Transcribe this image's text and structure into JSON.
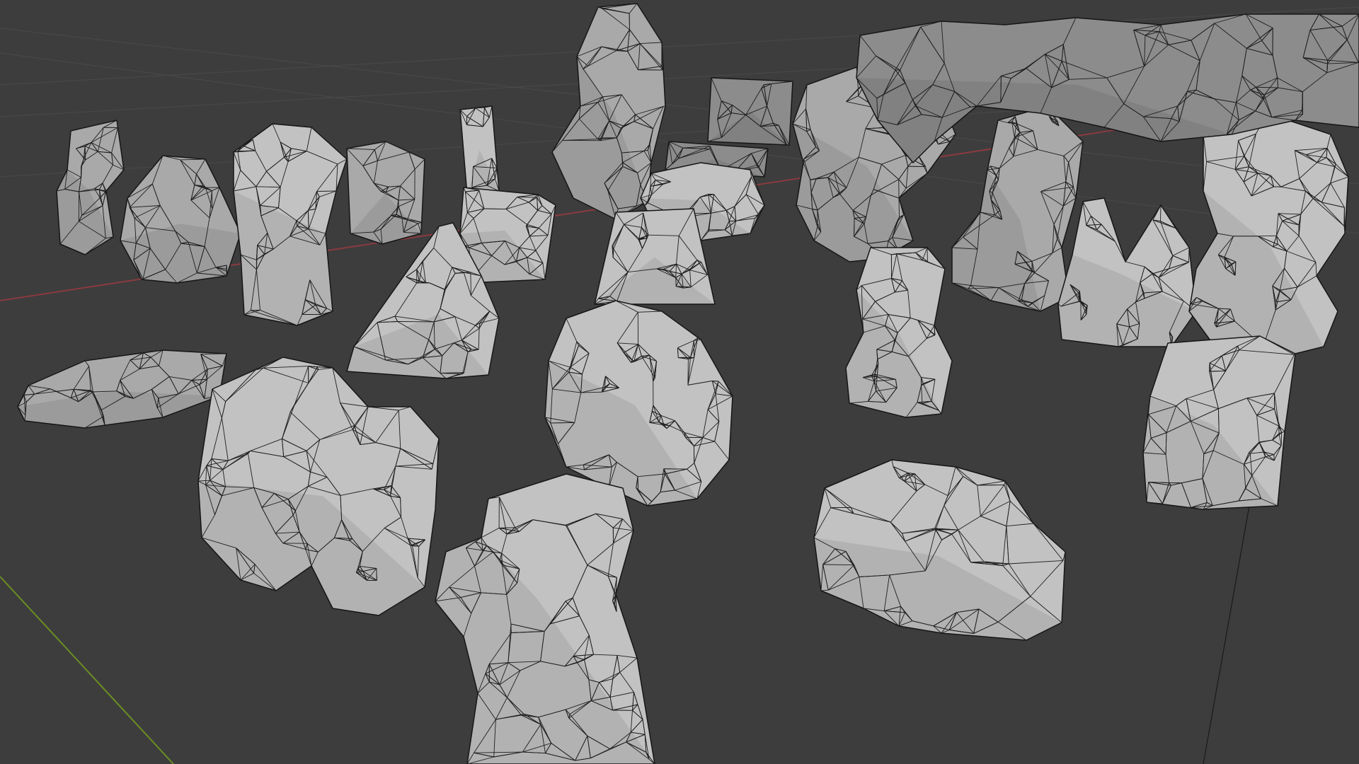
{
  "app": {
    "viewport": "3d-viewport",
    "shading": "solid-with-wireframe-overlay",
    "grid": true,
    "axes": [
      "x-axis-red",
      "y-axis-green"
    ]
  },
  "colors": {
    "background": "#3d3d3d",
    "grid_line": "#4a4a4a",
    "x_axis": "#8a3a3f",
    "y_axis": "#6b8e23",
    "mesh_light": "#c2c2c2",
    "mesh_mid": "#a9a9a9",
    "mesh_dark": "#8c8c8c",
    "wire": "#1e1e1e"
  },
  "scene": {
    "objects": [
      "rock-pillar-stacked-left",
      "rock-block-cluster",
      "rock-cross-pillar",
      "rock-twin-pillar",
      "rock-thin-pillar",
      "rock-pyramid",
      "rock-cube-tall",
      "rock-spiral-pillar-back",
      "rock-slab-sign",
      "rock-boulder-flat",
      "rock-frustum",
      "rock-large-boulder-left",
      "rock-flat-slab-left",
      "rock-boulder-center",
      "rock-twisted-column-front",
      "rock-cluster-right-center",
      "rock-stacked-column-right",
      "rock-spire-pair",
      "rock-big-cube-right",
      "rock-hexagon-cluster",
      "rock-dense-background"
    ]
  }
}
